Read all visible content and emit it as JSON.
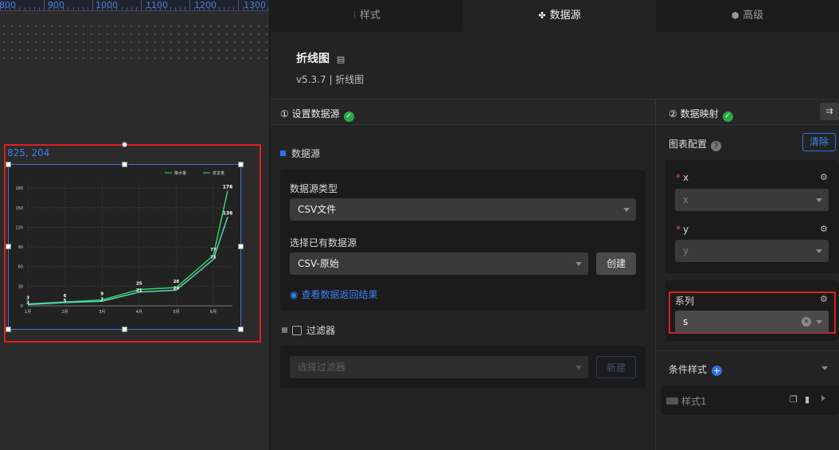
{
  "canvas": {
    "ruler_labels": [
      "800",
      "900",
      "1000",
      "1100",
      "1200",
      "1300"
    ],
    "coord_readout": "825, 204"
  },
  "tabs": [
    {
      "label": "样式",
      "icon": "sliders-icon"
    },
    {
      "label": "数据源",
      "icon": "datasource-icon",
      "active": true
    },
    {
      "label": "高级",
      "icon": "cube-icon"
    }
  ],
  "component": {
    "name": "折线图",
    "version": "v5.3.7 | 折线图"
  },
  "left_section": {
    "title": "① 设置数据源",
    "datasource_header": "数据源",
    "type_label": "数据源类型",
    "type_value": "CSV文件",
    "existing_label": "选择已有数据源",
    "existing_value": "CSV-原始",
    "create_label": "创建",
    "view_results": "查看数据返回结果",
    "filter_label": "过滤器",
    "filter_placeholder": "选择过滤器",
    "new_label": "新建"
  },
  "right_section": {
    "title": "② 数据映射",
    "chart_config": "图表配置",
    "clear_label": "清除",
    "x_label": "x",
    "x_value": "x",
    "y_label": "y",
    "y_value": "y",
    "series_label": "系列",
    "series_value": "s",
    "cond_style": "条件样式",
    "style1": "样式1"
  },
  "colors": {
    "accent": "#2f6fe6",
    "ok": "#2aa745",
    "highlight": "#e01e1e"
  },
  "chart_data": {
    "type": "line",
    "categories": [
      "1月",
      "2月",
      "3月",
      "4月",
      "5月",
      "6月"
    ],
    "series": [
      {
        "name": "降水量",
        "values": [
          3,
          6,
          9,
          25,
          28,
          77
        ],
        "color": "#2fd56b"
      },
      {
        "name": "蒸发量",
        "values": [
          2,
          5,
          7,
          21,
          24,
          71
        ],
        "color": "#5fd1c0"
      }
    ],
    "extra_point_labels": [
      {
        "series": 0,
        "value": 176
      },
      {
        "series": 1,
        "value": 136
      }
    ],
    "y_ticks": [
      0,
      30,
      60,
      90,
      120,
      150,
      180
    ],
    "ylim": [
      0,
      190
    ],
    "grid": true,
    "legend": "top-right"
  }
}
